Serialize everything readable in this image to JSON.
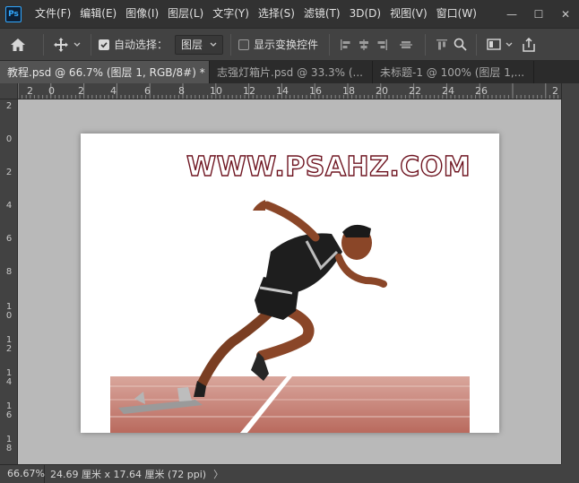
{
  "app": {
    "logo_text": "Ps",
    "menus": [
      "文件(F)",
      "编辑(E)",
      "图像(I)",
      "图层(L)",
      "文字(Y)",
      "选择(S)",
      "滤镜(T)",
      "3D(D)",
      "视图(V)",
      "窗口(W)"
    ],
    "window_controls": {
      "minimize": "—",
      "maximize": "☐",
      "close": "✕"
    }
  },
  "options_bar": {
    "home_icon": "home-icon",
    "move_tool_icon": "move-icon",
    "auto_select_label": "自动选择：",
    "auto_select_checked": true,
    "auto_select_target": "图层",
    "show_transform_label": "显示变换控件",
    "show_transform_checked": false
  },
  "tabs": [
    {
      "label": "教程.psd @ 66.7% (图层 1, RGB/8#) *",
      "active": true
    },
    {
      "label": "志强灯箱片.psd @ 33.3% (...",
      "active": false
    },
    {
      "label": "未标题-1 @ 100% (图层 1,...",
      "active": false
    }
  ],
  "ruler": {
    "top_labels": [
      "2",
      "0",
      "2",
      "4",
      "6",
      "8",
      "10",
      "12",
      "14",
      "16",
      "18",
      "20",
      "22",
      "24",
      "26",
      "2"
    ],
    "left_labels": [
      "2",
      "0",
      "2",
      "4",
      "6",
      "8",
      "10",
      "12",
      "14",
      "16",
      "18"
    ]
  },
  "document": {
    "watermark_text": "WWW.PSAHZ.COM"
  },
  "status": {
    "zoom": "66.67%",
    "doc_size": "24.69 厘米 x 17.64 厘米 (72 ppi)",
    "arrow": "〉"
  },
  "colors": {
    "accent": "#31a8ff",
    "watermark_outline": "#6e1420",
    "track": "#c98276"
  }
}
